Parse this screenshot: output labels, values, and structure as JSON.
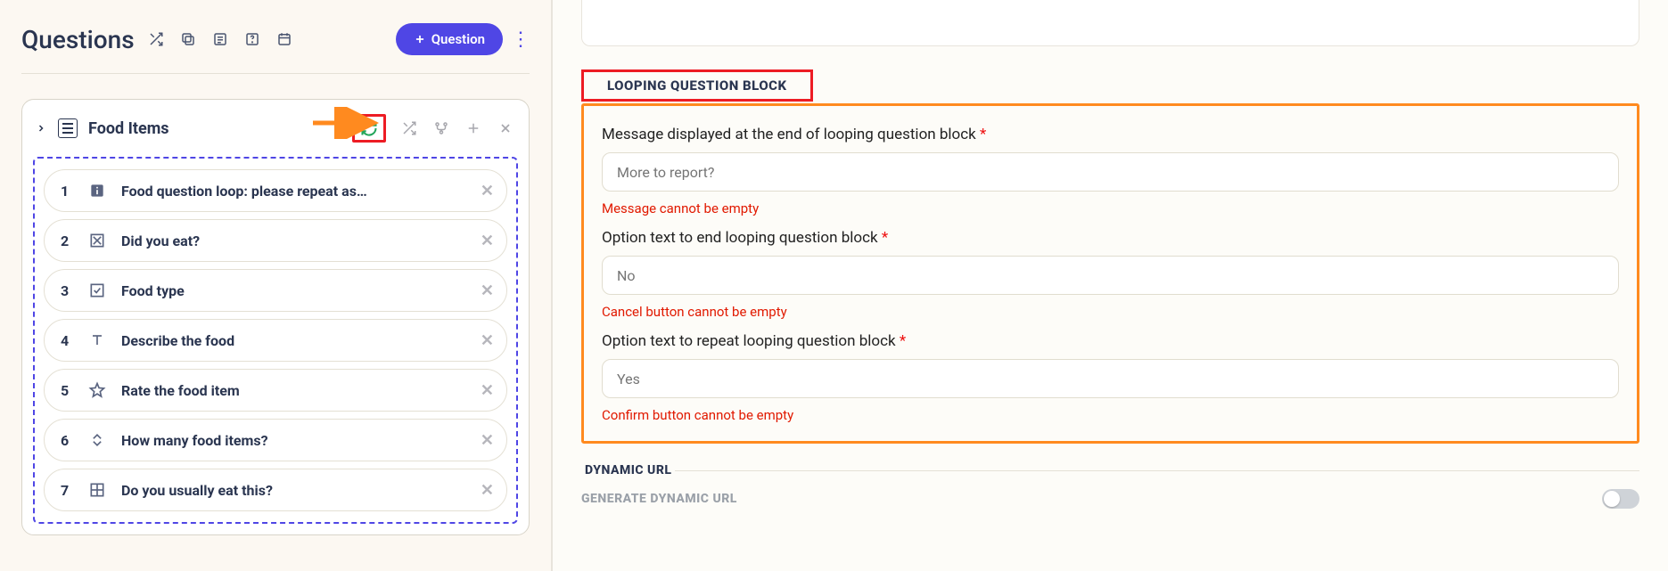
{
  "left": {
    "title": "Questions",
    "add_button": "Question",
    "block": {
      "title": "Food Items",
      "items": [
        {
          "num": "1",
          "text": "Food question loop: please repeat as…"
        },
        {
          "num": "2",
          "text": "Did you eat?"
        },
        {
          "num": "3",
          "text": "Food type"
        },
        {
          "num": "4",
          "text": "Describe the food"
        },
        {
          "num": "5",
          "text": "Rate the food item"
        },
        {
          "num": "6",
          "text": "How many food items?"
        },
        {
          "num": "7",
          "text": "Do you usually eat this?"
        }
      ]
    }
  },
  "right": {
    "section_title": "LOOPING QUESTION BLOCK",
    "f1_label": "Message displayed at the end of looping question block",
    "f1_ph": "More to report?",
    "f1_err": "Message cannot be empty",
    "f2_label": "Option text to end looping question block",
    "f2_ph": "No",
    "f2_err": "Cancel button cannot be empty",
    "f3_label": "Option text to repeat looping question block",
    "f3_ph": "Yes",
    "f3_err": "Confirm button cannot be empty",
    "dyn_title": "DYNAMIC URL",
    "dyn_label": "GENERATE DYNAMIC URL"
  }
}
